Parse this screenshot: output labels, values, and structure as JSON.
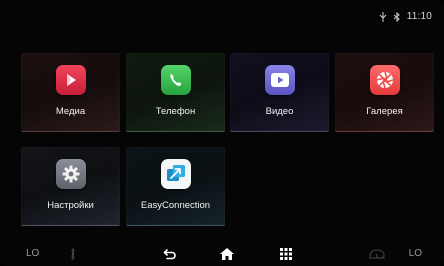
{
  "status_bar": {
    "icons": [
      "signal-icon",
      "bluetooth-icon"
    ],
    "time": "11:10"
  },
  "apps": [
    {
      "id": "media",
      "label": "Медиа",
      "icon": "media-play-icon",
      "color": "#e0324d"
    },
    {
      "id": "phone",
      "label": "Телефон",
      "icon": "phone-icon",
      "color": "#3cbf52"
    },
    {
      "id": "video",
      "label": "Видео",
      "icon": "video-play-icon",
      "color": "#6f68d8"
    },
    {
      "id": "gallery",
      "label": "Галерея",
      "icon": "camera-aperture-icon",
      "color": "#f24a4a"
    },
    {
      "id": "settings",
      "label": "Настройки",
      "icon": "gear-icon",
      "color": "#72777f"
    },
    {
      "id": "easy",
      "label": "EasyConnection",
      "icon": "easyconnection-icon",
      "color": "#1f8fc9"
    }
  ],
  "bottom_bar": {
    "left_label": "LO",
    "right_label": "LO",
    "icons": [
      "fan-icon",
      "back-icon",
      "home-icon",
      "apps-grid-icon",
      "recirculation-icon"
    ]
  }
}
